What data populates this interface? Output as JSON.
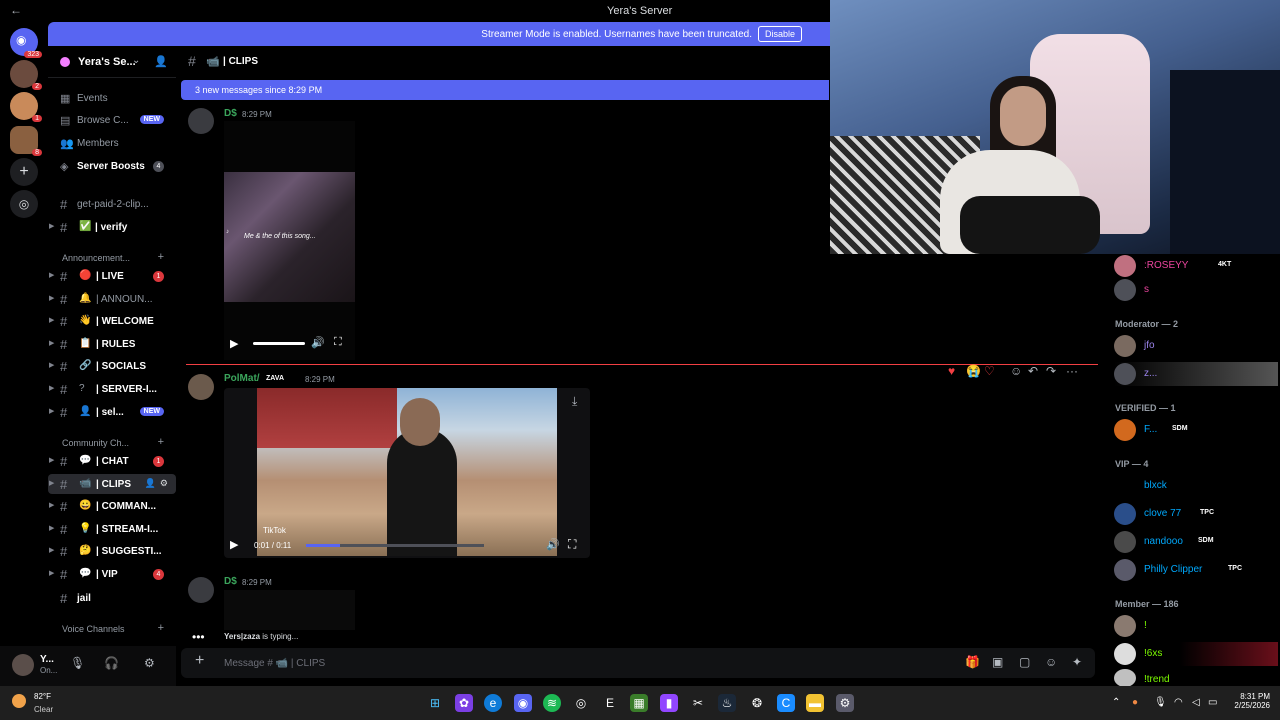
{
  "window": {
    "title": "Yera's Server"
  },
  "banner": {
    "text": "Streamer Mode is enabled. Usernames have been truncated.",
    "button": "Disable"
  },
  "guilds": {
    "home_badge": "323",
    "badges": [
      "2",
      "1",
      "8"
    ]
  },
  "server": {
    "name": "Yera's Se..."
  },
  "sidebar": {
    "top_items": [
      {
        "label": "Events",
        "icon": "calendar-icon"
      },
      {
        "label": "Browse C...",
        "icon": "browse-icon",
        "badge": "NEW"
      },
      {
        "label": "Members",
        "icon": "members-icon"
      },
      {
        "label": "Server Boosts",
        "icon": "boost-icon",
        "count": "4"
      }
    ],
    "get_paid": "get-paid-2-clip...",
    "verify": "| verify",
    "category_announcements": "Announcement...",
    "channels_a": [
      {
        "emoji": "🔴",
        "name": "| LIVE",
        "badge": "1"
      },
      {
        "emoji": "🔔",
        "name": "| ANNOUN...",
        "dim": true
      },
      {
        "emoji": "👋",
        "name": "| WELCOME"
      },
      {
        "emoji": "📋",
        "name": "| RULES"
      },
      {
        "emoji": "🔗",
        "name": "| SOCIALS"
      },
      {
        "emoji": "?",
        "name": "| SERVER-I..."
      },
      {
        "emoji": "👤",
        "name": "| sel...",
        "new": "NEW"
      }
    ],
    "category_community": "Community Ch...",
    "channels_b": [
      {
        "emoji": "💬",
        "name": "| CHAT",
        "badge": "1"
      },
      {
        "emoji": "📹",
        "name": "| CLIPS"
      },
      {
        "emoji": "😀",
        "name": "| COMMAN..."
      },
      {
        "emoji": "💡",
        "name": "| STREAM-I..."
      },
      {
        "emoji": "🤔",
        "name": "| SUGGESTI..."
      },
      {
        "emoji": "💬",
        "name": "| VIP",
        "badge": "4"
      }
    ],
    "jail": "jail",
    "category_voice": "Voice Channels"
  },
  "user": {
    "name": "Y...",
    "status": "On..."
  },
  "channel": {
    "emoji": "📹",
    "name": "| CLIPS"
  },
  "new_messages": "3 new messages since 8:29 PM",
  "messages": [
    {
      "author": "D$",
      "time": "8:29 PM",
      "author_color": "#3ba55c"
    },
    {
      "author": "PolMat/",
      "tag": "ZAVA",
      "time": "8:29 PM",
      "author_color": "#3ba55c",
      "video_time": "0:01 / 0:11",
      "tiktok": "TikTok"
    },
    {
      "author": "D$",
      "time": "8:29 PM",
      "author_color": "#3ba55c"
    }
  ],
  "clip_caption": "Me & the of this song...",
  "typing": {
    "user": "Yers|zaza",
    "text": " is typing..."
  },
  "composer": {
    "placeholder": "Message # 📹 | CLIPS"
  },
  "members": {
    "top_member": {
      "name": ":ROSEYY",
      "tag": "4KT"
    },
    "top_member2": {
      "name": "s"
    },
    "moderator_header": "Moderator — 2",
    "moderators": [
      {
        "name": "jfo"
      },
      {
        "name": "z..."
      }
    ],
    "verified_header": "VERIFIED — 1",
    "verified": [
      {
        "name": "F...",
        "tag": "SDM"
      }
    ],
    "vip_header": "VIP — 4",
    "vip": [
      {
        "name": "blxck"
      },
      {
        "name": "clove 77",
        "tag": "TPC"
      },
      {
        "name": "nandooo",
        "tag": "SDM"
      },
      {
        "name": "Philly Clipper",
        "tag": "TPC"
      }
    ],
    "member_header": "Member — 186",
    "member": [
      {
        "name": "!"
      },
      {
        "name": "!6xs"
      },
      {
        "name": "!trend"
      }
    ]
  },
  "taskbar": {
    "temp": "82°F",
    "weather": "Clear",
    "time": "8:31 PM",
    "date": "2/25/2026"
  },
  "colors": {
    "accent": "#5865f2",
    "mention_red": "#da373c",
    "online_green": "#3ba55c",
    "vip_blue": "#00a8fc",
    "member_green": "#7cfc00"
  }
}
